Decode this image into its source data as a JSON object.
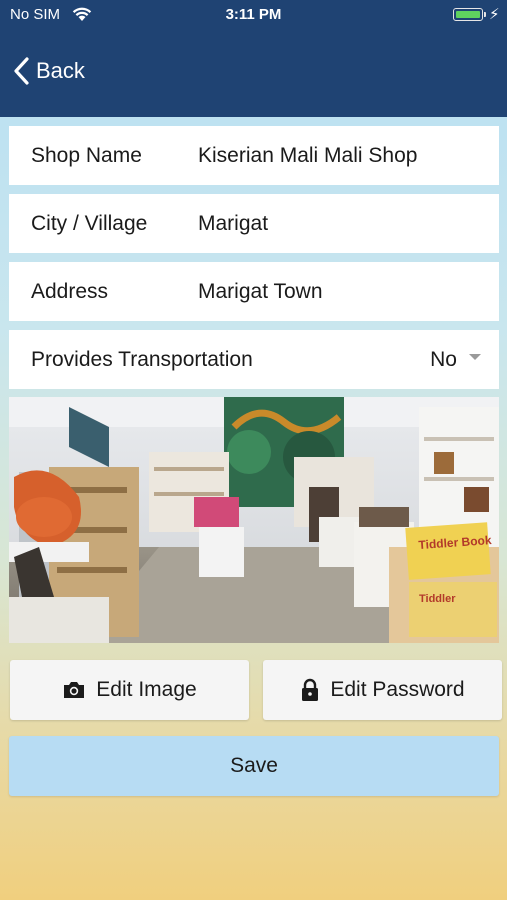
{
  "status_bar": {
    "carrier": "No SIM",
    "time": "3:11 PM",
    "charging_symbol": "⚡"
  },
  "nav": {
    "back_label": "Back"
  },
  "form": {
    "shop_name": {
      "label": "Shop Name",
      "value": "Kiserian Mali Mali Shop"
    },
    "city": {
      "label": "City / Village",
      "value": "Marigat"
    },
    "address": {
      "label": "Address",
      "value": "Marigat Town"
    },
    "transport": {
      "label": "Provides Transportation",
      "value": "No"
    }
  },
  "shop_image": {
    "signs": [
      "Tiddler Book",
      "Tiddler"
    ]
  },
  "actions": {
    "edit_image_label": "Edit Image",
    "edit_password_label": "Edit Password",
    "save_label": "Save"
  },
  "icons": {
    "wifi": "wifi-icon",
    "battery": "battery-icon",
    "back": "chevron-left-icon",
    "camera": "camera-icon",
    "lock": "lock-icon",
    "dropdown": "caret-down-icon"
  },
  "colors": {
    "nav_bar": "#1f4373",
    "save_button": "#b7dcf3",
    "battery_fill": "#5fd25f"
  }
}
